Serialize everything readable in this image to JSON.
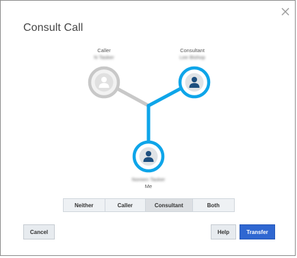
{
  "dialog": {
    "title": "Consult Call"
  },
  "icons": {
    "close": "close-icon",
    "person": "person-icon"
  },
  "colors": {
    "accent": "#0ea5e9",
    "inactive": "#c8c8c8",
    "primary_button": "#2f67d1"
  },
  "participants": {
    "caller": {
      "role": "Caller",
      "name": "N Tasker"
    },
    "consultant": {
      "role": "Consultant",
      "name": "Lee Bishop"
    },
    "me": {
      "name": "Noreen Tasker",
      "role": "Me"
    }
  },
  "listen_mode": {
    "options": [
      "Neither",
      "Caller",
      "Consultant",
      "Both"
    ],
    "selected": "Consultant"
  },
  "buttons": {
    "cancel": "Cancel",
    "help": "Help",
    "transfer": "Transfer"
  }
}
